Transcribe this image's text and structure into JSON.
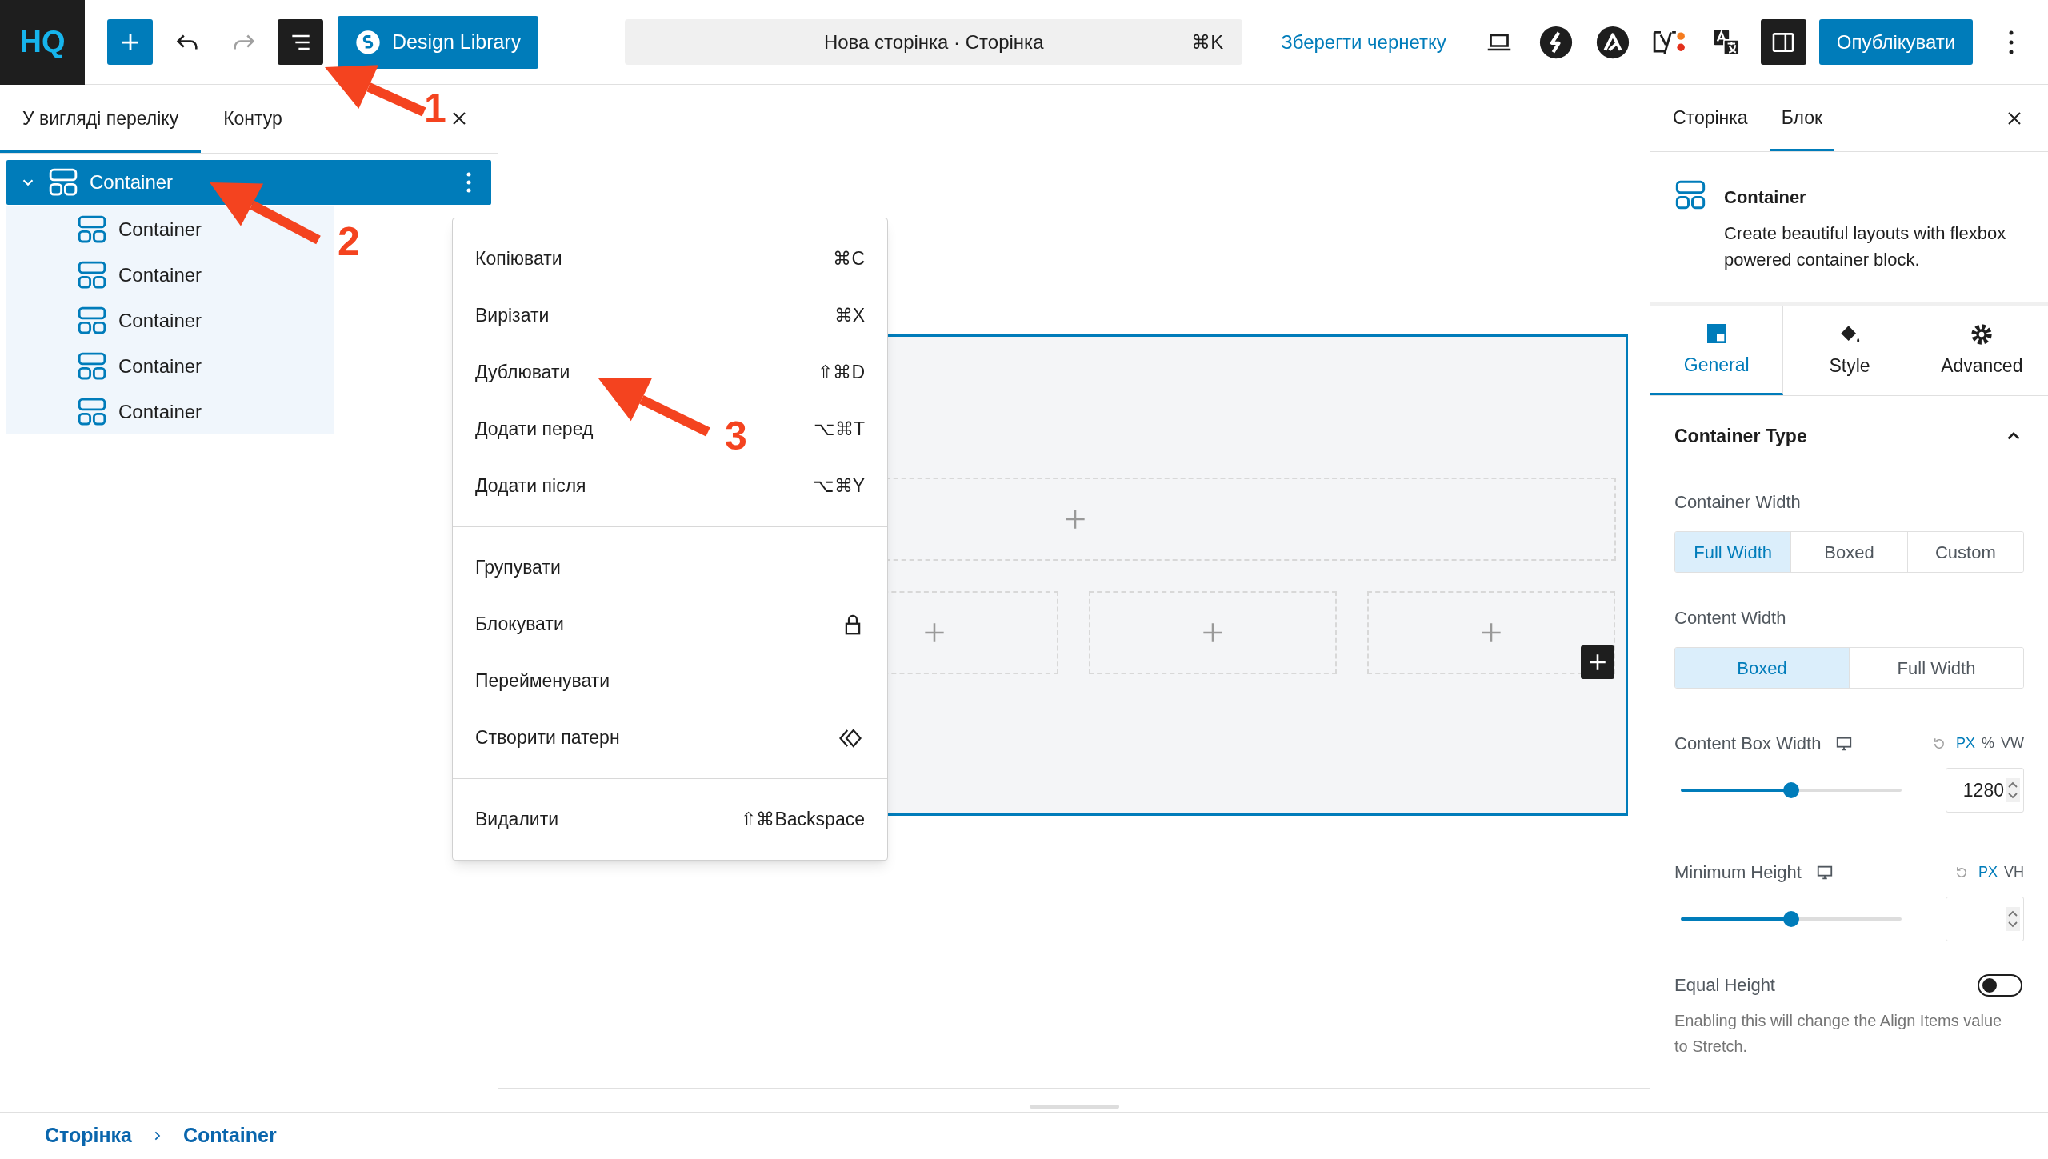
{
  "top_bar": {
    "logo": "HQ",
    "inserter": {
      "pressed": false
    },
    "redo": {
      "disabled": true
    },
    "list_view": {
      "pressed": true
    },
    "design_library": "Design Library",
    "command": {
      "title": "Нова сторінка · Сторінка",
      "shortcut": "⌘K"
    },
    "save_draft": "Зберегти чернетку",
    "settings_toggle": {
      "pressed": true
    },
    "publish": "Опублікувати"
  },
  "list_panel": {
    "tabs": [
      {
        "label": "У вигляді переліку",
        "selected": true
      },
      {
        "label": "Контур",
        "selected": false
      }
    ],
    "tree": [
      {
        "label": "Container",
        "selected": true,
        "expanded": true,
        "children": [
          {
            "label": "Container",
            "selected": false
          },
          {
            "label": "Container",
            "selected": false
          },
          {
            "label": "Container",
            "selected": false
          },
          {
            "label": "Container",
            "selected": false
          },
          {
            "label": "Container",
            "selected": false
          }
        ]
      }
    ]
  },
  "context_menu": {
    "groups": [
      [
        {
          "label": "Копіювати",
          "kind": "shortcut",
          "shortcut": "⌘C"
        },
        {
          "label": "Вирізати",
          "kind": "shortcut",
          "shortcut": "⌘X"
        },
        {
          "label": "Дублювати",
          "kind": "shortcut",
          "shortcut": "⇧⌘D"
        },
        {
          "label": "Додати перед",
          "kind": "shortcut",
          "shortcut": "⌥⌘T"
        },
        {
          "label": "Додати після",
          "kind": "shortcut",
          "shortcut": "⌥⌘Y"
        }
      ],
      [
        {
          "label": "Групувати",
          "kind": "plain"
        },
        {
          "label": "Блокувати",
          "kind": "lock"
        },
        {
          "label": "Перейменувати",
          "kind": "plain"
        },
        {
          "label": "Створити патерн",
          "kind": "pattern"
        }
      ],
      [
        {
          "label": "Видалити",
          "kind": "shortcut",
          "shortcut": "⇧⌘Backspace"
        }
      ]
    ]
  },
  "annotations": [
    {
      "label": "1"
    },
    {
      "label": "2"
    },
    {
      "label": "3"
    }
  ],
  "settings_panel": {
    "tabs": [
      {
        "label": "Сторінка",
        "selected": false
      },
      {
        "label": "Блок",
        "selected": true
      }
    ],
    "block": {
      "title": "Container",
      "description": "Create beautiful layouts with flexbox powered container block."
    },
    "sub_tabs": [
      {
        "label": "General",
        "kind": "general",
        "selected": true
      },
      {
        "label": "Style",
        "kind": "style",
        "selected": false
      },
      {
        "label": "Advanced",
        "kind": "advanced",
        "selected": false
      }
    ],
    "section": {
      "title": "Container Type",
      "expanded": true
    },
    "container_width": {
      "label": "Container Width",
      "options": [
        {
          "label": "Full Width",
          "selected": true
        },
        {
          "label": "Boxed",
          "selected": false
        },
        {
          "label": "Custom",
          "selected": false
        }
      ]
    },
    "content_width": {
      "label": "Content Width",
      "options": [
        {
          "label": "Boxed",
          "selected": true
        },
        {
          "label": "Full Width",
          "selected": false
        }
      ]
    },
    "content_box_width": {
      "label": "Content Box Width",
      "units": [
        {
          "label": "PX",
          "selected": true
        },
        {
          "label": "%",
          "selected": false
        },
        {
          "label": "VW",
          "selected": false
        }
      ],
      "level": 0.5,
      "value": "1280"
    },
    "minimum_height": {
      "label": "Minimum Height",
      "units": [
        {
          "label": "PX",
          "selected": true
        },
        {
          "label": "VH",
          "selected": false
        }
      ],
      "level": 0.5
    },
    "equal_height": {
      "label": "Equal Height",
      "on": false,
      "help": "Enabling this will change the Align Items value to Stretch."
    }
  },
  "breadcrumb": [
    "Сторінка",
    "Container"
  ]
}
